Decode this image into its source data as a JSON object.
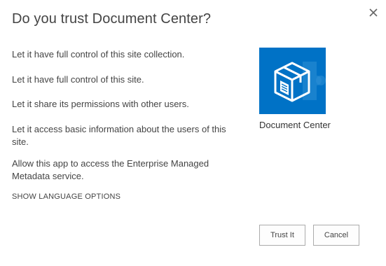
{
  "dialog": {
    "title": "Do you trust Document Center?",
    "close_icon": "close-icon",
    "permissions": [
      "Let it have full control of this site collection.",
      "Let it have full control of this site.",
      "Let it share its permissions with other users.",
      "Let it access basic information about the users of this site.",
      "Allow this app to access the Enterprise Managed Metadata service."
    ],
    "language_link": "SHOW LANGUAGE OPTIONS",
    "app": {
      "name": "Document Center",
      "icon": "document-box-icon",
      "tile_color": "#0072c6"
    },
    "buttons": {
      "trust": "Trust It",
      "cancel": "Cancel"
    }
  }
}
